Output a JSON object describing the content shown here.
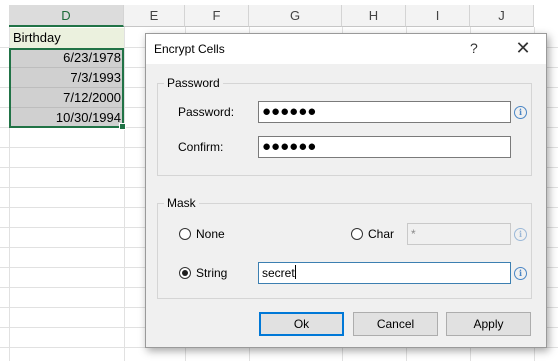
{
  "sheet": {
    "columns": [
      "D",
      "E",
      "F",
      "G",
      "H",
      "I",
      "J"
    ],
    "header_cell": "Birthday",
    "dates": [
      "6/23/1978",
      "7/3/1993",
      "7/12/2000",
      "10/30/1994"
    ]
  },
  "dialog": {
    "title": "Encrypt Cells",
    "help_glyph": "?",
    "close_glyph": "✕",
    "password_group": {
      "legend": "Password",
      "password_label": "Password:",
      "password_value": "●●●●●●",
      "confirm_label": "Confirm:",
      "confirm_value": "●●●●●●"
    },
    "mask_group": {
      "legend": "Mask",
      "none_label": "None",
      "char_label": "Char",
      "char_value": "*",
      "string_label": "String",
      "string_value": "secret",
      "selected": "String"
    },
    "buttons": {
      "ok": "Ok",
      "cancel": "Cancel",
      "apply": "Apply"
    }
  },
  "icons": {
    "info": "info-icon",
    "close": "close-icon",
    "help": "help-icon"
  },
  "colors": {
    "accent_green": "#217346",
    "header_fill": "#ebf1de",
    "selected_fill": "#d0d0d0",
    "focus_blue": "#0078d7",
    "info_blue": "#4a86c5"
  }
}
